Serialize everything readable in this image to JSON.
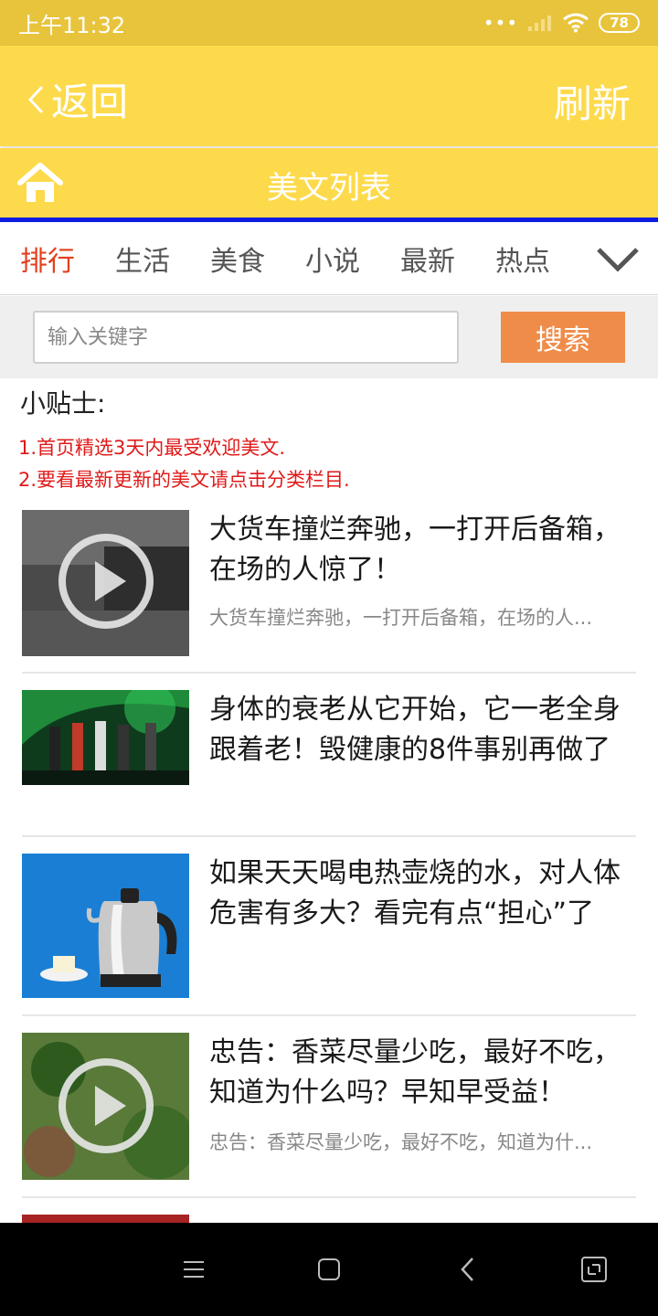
{
  "status_bar": {
    "time": "上午11:32",
    "battery": "78"
  },
  "header": {
    "back_label": "返回",
    "refresh_label": "刷新"
  },
  "title": "美文列表",
  "tabs": [
    {
      "label": "排行"
    },
    {
      "label": "生活"
    },
    {
      "label": "美食"
    },
    {
      "label": "小说"
    },
    {
      "label": "最新"
    },
    {
      "label": "热点"
    }
  ],
  "search": {
    "placeholder": "输入关键字",
    "button_label": "搜索"
  },
  "tips": {
    "title": "小贴士:",
    "lines": [
      "1.首页精选3天内最受欢迎美文.",
      "2.要看最新更新的美文请点击分类栏目."
    ]
  },
  "articles": [
    {
      "title": "大货车撞烂奔驰，一打开后备箱，在场的人惊了！",
      "summary": "大货车撞烂奔驰，一打开后备箱，在场的人...",
      "thumb": "video-car"
    },
    {
      "title": "身体的衰老从它开始，它一老全身跟着老！毁健康的8件事别再做了",
      "summary": "",
      "thumb": "tv-show"
    },
    {
      "title": "如果天天喝电热壶烧的水，对人体危害有多大？看完有点“担心”了",
      "summary": "",
      "thumb": "kettle"
    },
    {
      "title": "忠告：香菜尽量少吃，最好不吃，知道为什么吗？早知早受益！",
      "summary": "忠告：香菜尽量少吃，最好不吃，知道为什...",
      "thumb": "video-greens"
    }
  ],
  "colors": {
    "header_bg": "#fdda4b",
    "accent_blue": "#0a1ce0",
    "active_tab": "#e2401c",
    "search_btn": "#f08c4a",
    "tip_red": "#e01919"
  }
}
